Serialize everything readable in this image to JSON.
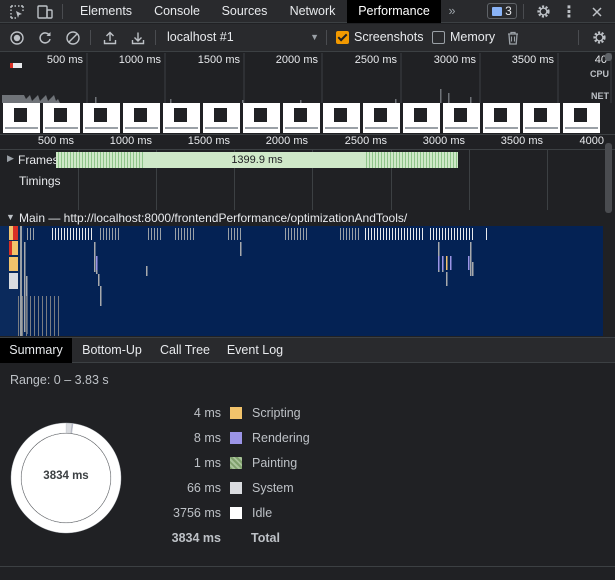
{
  "tabs": {
    "items": [
      {
        "label": "Elements"
      },
      {
        "label": "Console"
      },
      {
        "label": "Sources"
      },
      {
        "label": "Network"
      },
      {
        "label": "Performance"
      }
    ],
    "overflow": "»",
    "issues_count": "3"
  },
  "toolbar": {
    "profile": "localhost #1",
    "screenshots_label": "Screenshots",
    "screenshots_checked": true,
    "memory_label": "Memory",
    "memory_checked": false
  },
  "overview": {
    "ticks": [
      "500 ms",
      "1000 ms",
      "1500 ms",
      "2000 ms",
      "2500 ms",
      "3000 ms",
      "3500 ms",
      "40"
    ],
    "cpu_label": "CPU",
    "net_label": "NET"
  },
  "detail": {
    "ticks": [
      "500 ms",
      "1000 ms",
      "1500 ms",
      "2000 ms",
      "2500 ms",
      "3000 ms",
      "3500 ms",
      "4000"
    ]
  },
  "tracks": {
    "frames_label": "Frames",
    "frames_duration": "1399.9 ms",
    "timings_label": "Timings",
    "main_label": "Main — http://localhost:8000/frontendPerformance/optimizationAndTools/"
  },
  "bottom_tabs": [
    "Summary",
    "Bottom-Up",
    "Call Tree",
    "Event Log"
  ],
  "summary": {
    "range": "Range: 0 – 3.83 s",
    "total_ms": 3834,
    "donut_label": "3834 ms",
    "items": [
      {
        "value": "4 ms",
        "ms": 4,
        "name": "Scripting",
        "color": "#f2c36b"
      },
      {
        "value": "8 ms",
        "ms": 8,
        "name": "Rendering",
        "color": "#9b94e6"
      },
      {
        "value": "1 ms",
        "ms": 1,
        "name": "Painting",
        "color": "#7fa06c"
      },
      {
        "value": "66 ms",
        "ms": 66,
        "name": "System",
        "color": "#dadce0"
      },
      {
        "value": "3756 ms",
        "ms": 3756,
        "name": "Idle",
        "color": "#ffffff"
      }
    ],
    "total_value": "3834 ms",
    "total_name": "Total"
  },
  "colors": {
    "accent_orange": "#f29900",
    "flame_bg": "#042254",
    "frames_green": "#cfe8c8"
  }
}
